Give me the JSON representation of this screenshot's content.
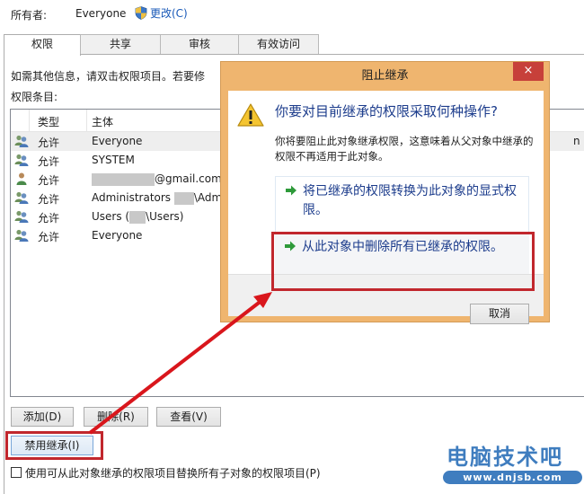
{
  "owner": {
    "label": "所有者:",
    "value": "Everyone",
    "change_link": "更改(C)"
  },
  "tabs": [
    {
      "label": "权限",
      "active": true
    },
    {
      "label": "共享",
      "active": false
    },
    {
      "label": "审核",
      "active": false
    },
    {
      "label": "有效访问",
      "active": false
    }
  ],
  "info_text": "如需其他信息，请双击权限项目。若要修",
  "entries_label": "权限条目:",
  "permission_list": {
    "headers": {
      "type": "类型",
      "principal": "主体"
    },
    "rows": [
      {
        "icon": "group-users-icon",
        "type": "允许",
        "principal": "Everyone",
        "redacted_after": false,
        "suffix": "",
        "trailing": "n ..."
      },
      {
        "icon": "group-users-icon",
        "type": "允许",
        "principal": "SYSTEM",
        "suffix": ""
      },
      {
        "icon": "single-user-icon",
        "type": "允许",
        "principal": "",
        "suffix": "@gmail.com"
      },
      {
        "icon": "group-users-icon",
        "type": "允许",
        "principal": "Administrators ",
        "suffix": "\\Admi"
      },
      {
        "icon": "group-users-icon",
        "type": "允许",
        "principal": "Users (",
        "suffix": "\\Users)"
      },
      {
        "icon": "group-users-icon",
        "type": "允许",
        "principal": "Everyone",
        "suffix": ""
      }
    ]
  },
  "buttons": {
    "add": "添加(D)",
    "remove": "删除(R)",
    "view": "查看(V)",
    "disable_inheritance": "禁用继承(I)"
  },
  "replace_checkbox": {
    "label": "使用可从此对象继承的权限项目替换所有子对象的权限项目(P)",
    "checked": false
  },
  "dialog": {
    "title": "阻止继承",
    "close_glyph": "×",
    "heading": "你要对目前继承的权限采取何种操作?",
    "description": "你将要阻止此对象继承权限，这意味着从父对象中继承的权限不再适用于此对象。",
    "options": [
      {
        "label": "将已继承的权限转换为此对象的显式权限。",
        "highlighted": false
      },
      {
        "label": "从此对象中删除所有已继承的权限。",
        "highlighted": true
      }
    ],
    "cancel": "取消"
  },
  "watermark": {
    "title": "电脑技术吧",
    "url": "www.dnjsb.com"
  },
  "colors": {
    "dialog_frame": "#efb56f",
    "close_button": "#c7403a",
    "heading_blue": "#1c3c8c",
    "annotation_red": "#c1272d",
    "watermark_blue": "#3f7dbf"
  }
}
